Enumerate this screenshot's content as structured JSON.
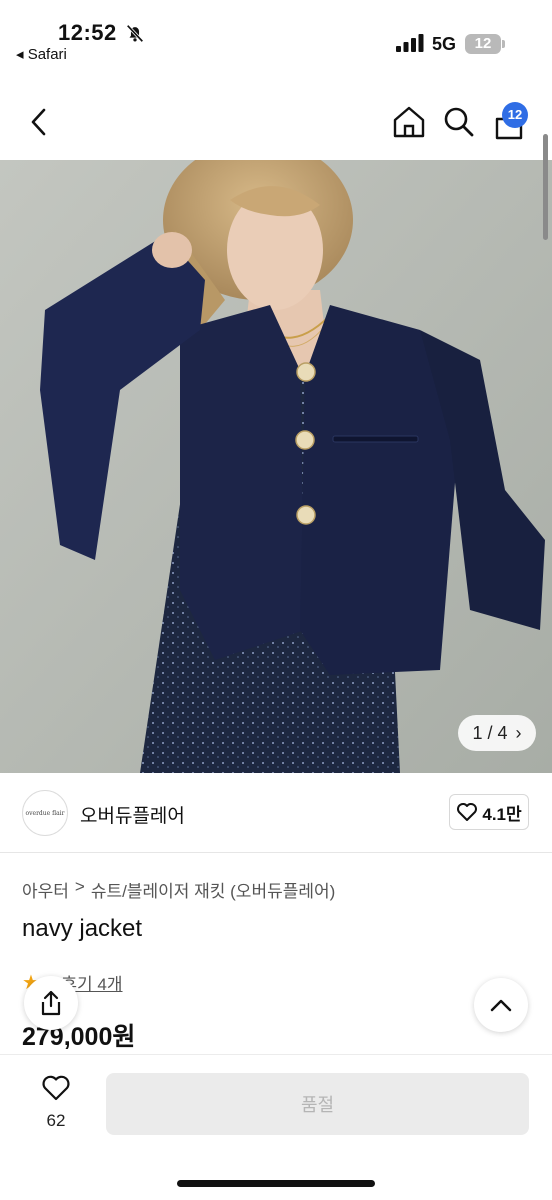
{
  "status": {
    "time": "12:52",
    "back_app": "◂ Safari",
    "network": "5G",
    "battery": "12"
  },
  "header": {
    "cart_badge": "12",
    "icons": [
      "back-icon",
      "home-icon",
      "search-icon",
      "bag-icon"
    ]
  },
  "gallery": {
    "current": "1",
    "total": "4",
    "counter_text": "1 / 4"
  },
  "brand": {
    "logo_text": "overdue flair",
    "name": "오버듀플레어",
    "likes": "4.1만"
  },
  "product": {
    "breadcrumb": [
      "아우터",
      "슈트/블레이저 재킷 (오버듀플레어)"
    ],
    "breadcrumb_sep": ">",
    "title": "navy jacket",
    "rating": "5",
    "reviews": "후기 4개",
    "price": "279,000원"
  },
  "bottom": {
    "wish_count": "62",
    "soldout_label": "품절"
  },
  "colors": {
    "accent": "#2f6de5",
    "star": "#f2a413",
    "jacket": "#1c2448"
  }
}
